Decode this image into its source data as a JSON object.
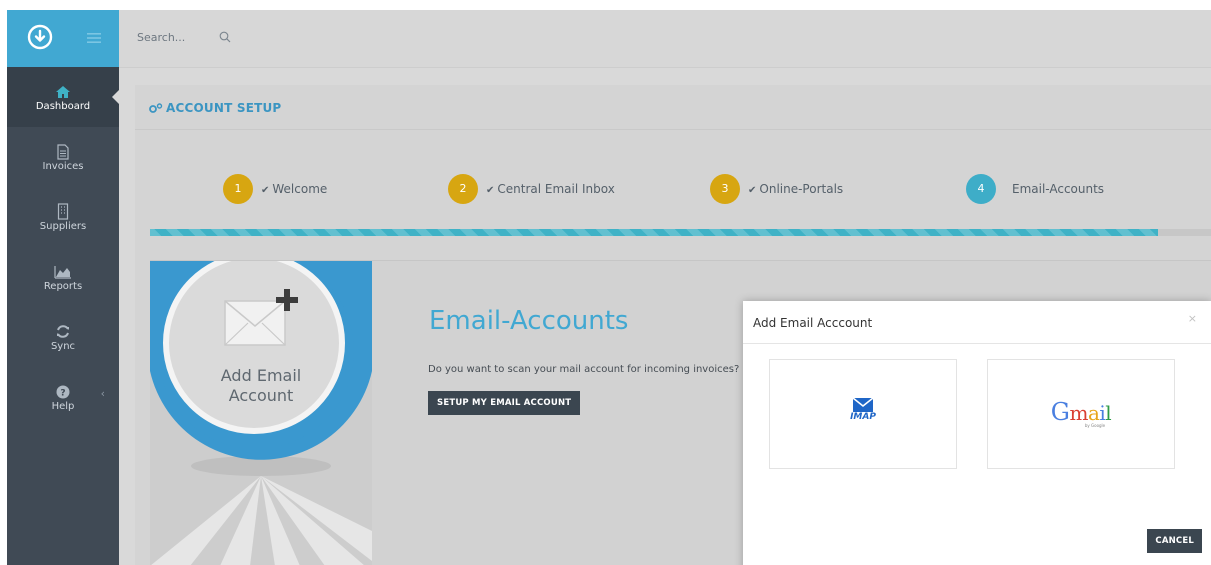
{
  "topbar": {
    "search_placeholder": "Search..."
  },
  "sidebar": {
    "items": [
      {
        "label": "Dashboard",
        "icon": "home-icon",
        "active": true
      },
      {
        "label": "Invoices",
        "icon": "document-icon"
      },
      {
        "label": "Suppliers",
        "icon": "building-icon"
      },
      {
        "label": "Reports",
        "icon": "area-chart-icon"
      },
      {
        "label": "Sync",
        "icon": "refresh-icon"
      },
      {
        "label": "Help",
        "icon": "question-circle-icon"
      }
    ]
  },
  "panel": {
    "title": "ACCOUNT SETUP",
    "steps": [
      {
        "number": "1",
        "label": "Welcome",
        "done": true
      },
      {
        "number": "2",
        "label": "Central Email Inbox",
        "done": true
      },
      {
        "number": "3",
        "label": "Online-Portals",
        "done": true
      },
      {
        "number": "4",
        "label": "Email-Accounts",
        "done": false
      }
    ],
    "progress_percent": 95
  },
  "content": {
    "hero_text_line1": "Add Email",
    "hero_text_line2": "Account",
    "title": "Email-Accounts",
    "question": "Do you want to scan your mail account for incoming invoices?",
    "setup_button": "SETUP MY EMAIL ACCOUNT"
  },
  "modal": {
    "title": "Add Email Acccount",
    "close_symbol": "×",
    "option_imap_label": "IMAP",
    "option_gmail_label": "Gmail",
    "option_gmail_by": "by Google",
    "cancel_button": "CANCEL"
  },
  "colors": {
    "brand": "#41a8d2",
    "sidebar": "#404a55",
    "step_done": "#d7a611",
    "step_current": "#3eadc8",
    "progress": "#3fb2c6",
    "button_dark": "#3b4650"
  }
}
